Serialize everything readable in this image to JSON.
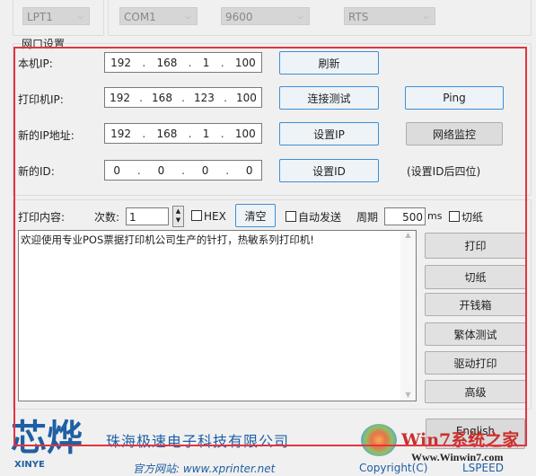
{
  "top": {
    "parallel_port": "LPT1",
    "serial_port": "COM1",
    "baud": "9600",
    "flow": "RTS"
  },
  "net": {
    "group_title": "网口设置",
    "local_ip": {
      "label": "本机IP:",
      "octets": [
        "192",
        "168",
        "1",
        "100"
      ]
    },
    "printer_ip": {
      "label": "打印机IP:",
      "octets": [
        "192",
        "168",
        "123",
        "100"
      ]
    },
    "new_ip": {
      "label": "新的IP地址:",
      "octets": [
        "192",
        "168",
        "1",
        "100"
      ]
    },
    "new_id": {
      "label": "新的ID:",
      "octets": [
        "0",
        "0",
        "0",
        "0"
      ]
    },
    "refresh": "刷新",
    "connect_test": "连接测试",
    "ping": "Ping",
    "set_ip": "设置IP",
    "net_monitor": "网络监控",
    "set_id": "设置ID",
    "id_hint": "(设置ID后四位)"
  },
  "print": {
    "content_label": "打印内容:",
    "count_label": "次数:",
    "count": "1",
    "hex": "HEX",
    "clear": "清空",
    "auto_send": "自动发送",
    "period_label": "周期",
    "period": "500",
    "ms": "ms",
    "cut": "切纸",
    "text": "欢迎使用专业POS票据打印机公司生产的针打，热敏系列打印机!",
    "buttons": [
      "打印",
      "切纸",
      "开钱箱",
      "繁体测试",
      "驱动打印",
      "高级"
    ]
  },
  "footer": {
    "logo": "芯烨",
    "logo_sub": "XINYE",
    "company": "珠海极速电子科技有限公司",
    "english": "English",
    "website": "官方网站: www.xprinter.net",
    "copyright": "Copyright(C)",
    "lspeed": "LSPEED",
    "watermark": "Win7系统之家",
    "watermark_url": "Www.Winwin7.com"
  }
}
